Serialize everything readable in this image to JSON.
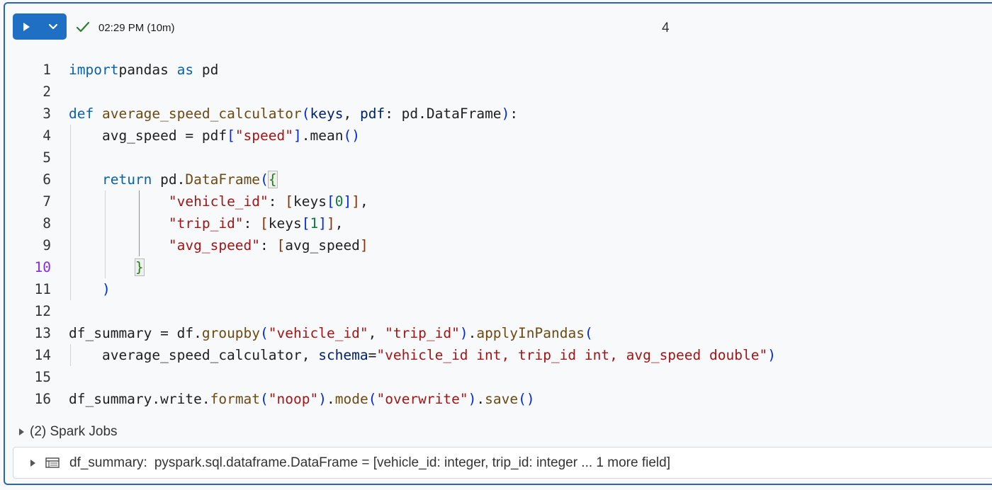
{
  "cell": {
    "status_time": "02:29 PM (10m)",
    "cell_number": "4",
    "icons": {
      "run": "play-icon",
      "menu": "chevron-down-icon",
      "status": "check-icon"
    }
  },
  "code": {
    "active_line": 10,
    "lines": [
      {
        "n": "1",
        "tokens": [
          [
            "kw",
            "import"
          ],
          [
            "",
            "pandas "
          ],
          [
            "kw",
            "as"
          ],
          [
            "",
            " pd"
          ]
        ]
      },
      {
        "n": "2",
        "tokens": []
      },
      {
        "n": "3",
        "tokens": [
          [
            "kw",
            "def"
          ],
          [
            "",
            " "
          ],
          [
            "fn",
            "average_speed_calculator"
          ],
          [
            "br1",
            "("
          ],
          [
            "param",
            "keys"
          ],
          [
            "",
            ", "
          ],
          [
            "param",
            "pdf"
          ],
          [
            "",
            ": pd.DataFrame"
          ],
          [
            "br1",
            ")"
          ],
          [
            "",
            ":"
          ]
        ]
      },
      {
        "n": "4",
        "tokens": [
          [
            "",
            "    avg_speed = pdf"
          ],
          [
            "br1",
            "["
          ],
          [
            "str",
            "\"speed\""
          ],
          [
            "br1",
            "]"
          ],
          [
            "",
            ".mean"
          ],
          [
            "br1",
            "()"
          ]
        ]
      },
      {
        "n": "5",
        "tokens": []
      },
      {
        "n": "6",
        "tokens": [
          [
            "",
            "    "
          ],
          [
            "kw",
            "return"
          ],
          [
            "",
            " pd."
          ],
          [
            "fn",
            "DataFrame"
          ],
          [
            "br1",
            "("
          ],
          [
            "br2box",
            "{"
          ]
        ]
      },
      {
        "n": "7",
        "tokens": [
          [
            "",
            "            "
          ],
          [
            "str",
            "\"vehicle_id\""
          ],
          [
            "",
            ": "
          ],
          [
            "br3",
            "["
          ],
          [
            "",
            "keys"
          ],
          [
            "br1",
            "["
          ],
          [
            "num",
            "0"
          ],
          [
            "br1",
            "]"
          ],
          [
            "br3",
            "]"
          ],
          [
            "",
            ","
          ]
        ]
      },
      {
        "n": "8",
        "tokens": [
          [
            "",
            "            "
          ],
          [
            "str",
            "\"trip_id\""
          ],
          [
            "",
            ": "
          ],
          [
            "br3",
            "["
          ],
          [
            "",
            "keys"
          ],
          [
            "br1",
            "["
          ],
          [
            "num",
            "1"
          ],
          [
            "br1",
            "]"
          ],
          [
            "br3",
            "]"
          ],
          [
            "",
            ","
          ]
        ]
      },
      {
        "n": "9",
        "tokens": [
          [
            "",
            "            "
          ],
          [
            "str",
            "\"avg_speed\""
          ],
          [
            "",
            ": "
          ],
          [
            "br3",
            "["
          ],
          [
            "",
            "avg_speed"
          ],
          [
            "br3",
            "]"
          ]
        ]
      },
      {
        "n": "10",
        "tokens": [
          [
            "",
            "        "
          ],
          [
            "br2box",
            "}"
          ]
        ]
      },
      {
        "n": "11",
        "tokens": [
          [
            "",
            "    "
          ],
          [
            "br1",
            ")"
          ]
        ]
      },
      {
        "n": "12",
        "tokens": []
      },
      {
        "n": "13",
        "tokens": [
          [
            "",
            "df_summary = df."
          ],
          [
            "fn",
            "groupby"
          ],
          [
            "br1",
            "("
          ],
          [
            "str",
            "\"vehicle_id\""
          ],
          [
            "",
            ", "
          ],
          [
            "str",
            "\"trip_id\""
          ],
          [
            "br1",
            ")"
          ],
          [
            "",
            "."
          ],
          [
            "fn",
            "applyInPandas"
          ],
          [
            "br1",
            "("
          ]
        ]
      },
      {
        "n": "14",
        "tokens": [
          [
            "",
            "    average_speed_calculator, "
          ],
          [
            "param",
            "schema"
          ],
          [
            "",
            "="
          ],
          [
            "str",
            "\"vehicle_id int, trip_id int, avg_speed double\""
          ],
          [
            "br1",
            ")"
          ]
        ]
      },
      {
        "n": "15",
        "tokens": []
      },
      {
        "n": "16",
        "tokens": [
          [
            "",
            "df_summary.write."
          ],
          [
            "fn",
            "format"
          ],
          [
            "br1",
            "("
          ],
          [
            "str",
            "\"noop\""
          ],
          [
            "br1",
            ")"
          ],
          [
            "",
            "."
          ],
          [
            "fn",
            "mode"
          ],
          [
            "br1",
            "("
          ],
          [
            "str",
            "\"overwrite\""
          ],
          [
            "br1",
            ")"
          ],
          [
            "",
            "."
          ],
          [
            "fn",
            "save"
          ],
          [
            "br1",
            "()"
          ]
        ]
      }
    ]
  },
  "spark_jobs": {
    "label": "(2) Spark Jobs",
    "icon": "caret-right-icon"
  },
  "result": {
    "name": "df_summary:",
    "type": "pyspark.sql.dataframe.DataFrame = [vehicle_id: integer, trip_id: integer ... 1 more field]",
    "icon": "table-icon"
  }
}
